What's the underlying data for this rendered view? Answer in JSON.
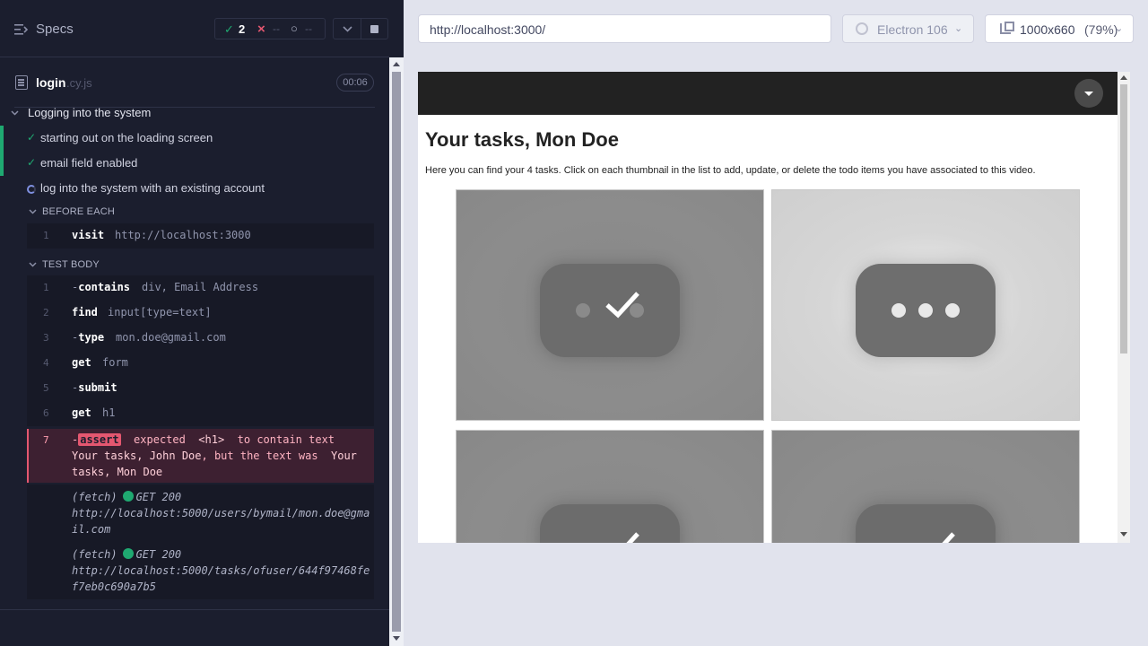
{
  "specs": {
    "title": "Specs",
    "stats": {
      "passed": "2",
      "failed": "--",
      "pending": "--"
    }
  },
  "file": {
    "name": "login",
    "ext": ".cy.js",
    "duration": "00:06"
  },
  "suite": {
    "title": "Logging into the system",
    "tests": [
      {
        "label": "starting out on the loading screen",
        "state": "passed"
      },
      {
        "label": "email field enabled",
        "state": "passed"
      },
      {
        "label": "log into the system with an existing account",
        "state": "running"
      }
    ]
  },
  "before_each": {
    "title": "BEFORE EACH",
    "commands": [
      {
        "num": "1",
        "name": "visit",
        "message": "http://localhost:3000"
      }
    ]
  },
  "test_body": {
    "title": "TEST BODY",
    "commands": [
      {
        "num": "1",
        "prefix": "-",
        "name": "contains",
        "message": "div, Email Address"
      },
      {
        "num": "2",
        "prefix": "",
        "name": "find",
        "message": "input[type=text]"
      },
      {
        "num": "3",
        "prefix": "-",
        "name": "type",
        "message": "mon.doe@gmail.com"
      },
      {
        "num": "4",
        "prefix": "",
        "name": "get",
        "message": "form"
      },
      {
        "num": "5",
        "prefix": "-",
        "name": "submit",
        "message": ""
      },
      {
        "num": "6",
        "prefix": "",
        "name": "get",
        "message": "h1"
      }
    ],
    "failed": {
      "num": "7",
      "badge": "assert",
      "part1": "expected",
      "tag": "<h1>",
      "part2": "to contain text",
      "expected_text": "Your tasks, John Doe",
      "part3": ", but the text was",
      "actual_text": "Your tasks, Mon Doe"
    },
    "fetches": [
      {
        "label": "(fetch)",
        "method": "GET 200",
        "url": "http://localhost:5000/users/bymail/mon.doe@gmail.com"
      },
      {
        "label": "(fetch)",
        "method": "GET 200",
        "url": "http://localhost:5000/tasks/ofuser/644f97468fef7eb0c690a7b5"
      }
    ]
  },
  "preview": {
    "url": "http://localhost:3000/",
    "browser": "Electron 106",
    "viewport": "1000x660",
    "scale": "(79%)"
  },
  "aut": {
    "title": "Your tasks, Mon Doe",
    "description": "Here you can find your 4 tasks. Click on each thumbnail in the list to add, update, or delete the todo items you have associated to this video."
  },
  "colors": {
    "pass": "#1fa971",
    "fail": "#e45770",
    "running": "#7f90e0",
    "background": "#1b1e2e"
  }
}
